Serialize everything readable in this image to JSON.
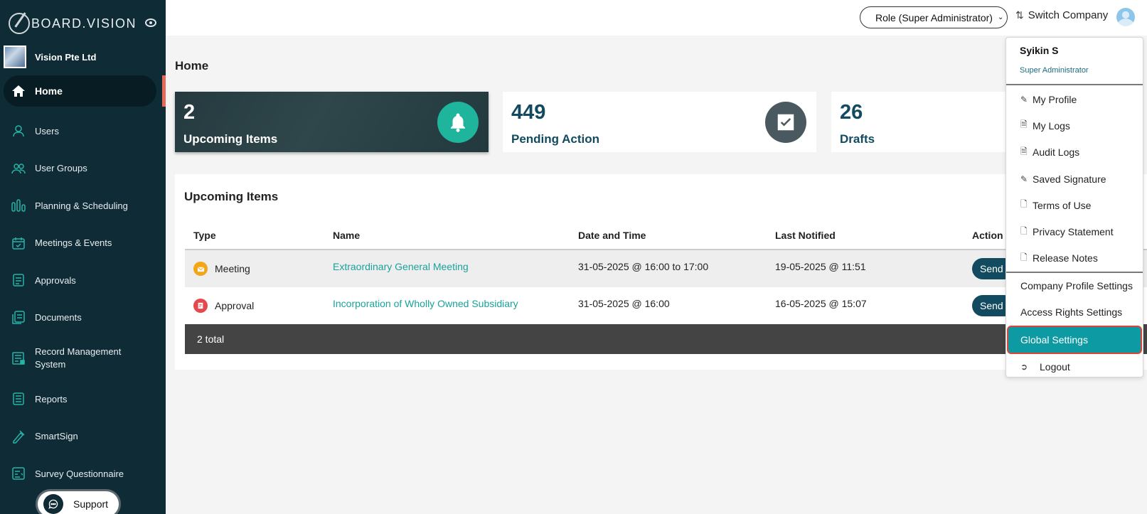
{
  "brand": {
    "name": "BOARD.VISION"
  },
  "company": {
    "name": "Vision Pte Ltd"
  },
  "sidebar": {
    "items": [
      {
        "label": "Home",
        "icon": "home-icon"
      },
      {
        "label": "Users",
        "icon": "user-icon"
      },
      {
        "label": "User Groups",
        "icon": "users-icon"
      },
      {
        "label": "Planning & Scheduling",
        "icon": "bars-icon"
      },
      {
        "label": "Meetings & Events",
        "icon": "calendar-icon"
      },
      {
        "label": "Approvals",
        "icon": "approvals-icon"
      },
      {
        "label": "Documents",
        "icon": "documents-icon"
      },
      {
        "label": "Record Management System",
        "icon": "records-icon"
      },
      {
        "label": "Reports",
        "icon": "reports-icon"
      },
      {
        "label": "SmartSign",
        "icon": "pen-icon"
      },
      {
        "label": "Survey Questionnaire",
        "icon": "survey-icon"
      }
    ],
    "support_label": "Support"
  },
  "topbar": {
    "role_label": "Role (Super Administrator)",
    "switch_company_label": "Switch Company"
  },
  "main": {
    "title": "Home",
    "stats": [
      {
        "value": "2",
        "label": "Upcoming Items",
        "icon": "bell-icon"
      },
      {
        "value": "449",
        "label": "Pending Action",
        "icon": "checkbox-icon"
      },
      {
        "value": "26",
        "label": "Drafts"
      }
    ],
    "upcoming": {
      "title": "Upcoming Items",
      "columns": [
        "Type",
        "Name",
        "Date and Time",
        "Last Notified",
        "Action"
      ],
      "rows": [
        {
          "type": "Meeting",
          "name": "Extraordinary General Meeting",
          "datetime": "31-05-2025 @ 16:00 to 17:00",
          "last_notified": "19-05-2025 @ 11:51",
          "action": "Send"
        },
        {
          "type": "Approval",
          "name": "Incorporation of Wholly Owned Subsidiary",
          "datetime": "31-05-2025 @ 16:00",
          "last_notified": "16-05-2025 @ 15:07",
          "action": "Send"
        }
      ],
      "total": "2 total"
    }
  },
  "user_menu": {
    "name": "Syikin S",
    "role": "Super Administrator",
    "items_personal": [
      "My Profile",
      "My Logs",
      "Audit Logs",
      "Saved Signature",
      "Terms of Use",
      "Privacy Statement",
      "Release Notes"
    ],
    "items_settings": [
      "Company Profile Settings",
      "Access Rights Settings",
      "Global Settings"
    ],
    "logout_label": "Logout"
  },
  "colors": {
    "sidebar_bg": "#0f2b35",
    "accent_teal": "#0e9aa3",
    "primary_dark": "#124b5f",
    "highlight_border": "#d9473a"
  }
}
